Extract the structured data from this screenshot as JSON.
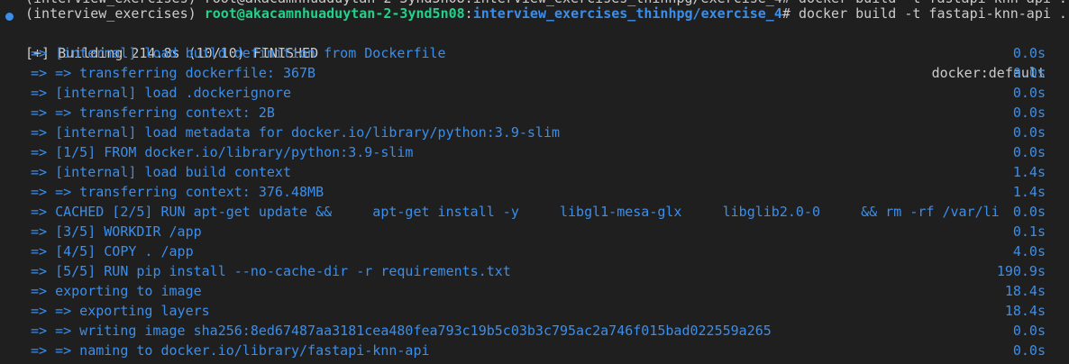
{
  "colors": {
    "background": "#1f1f1f",
    "text": "#cccccc",
    "step_text": "#3b8eea",
    "user_host": "#23d18b",
    "cwd": "#3b8eea",
    "prompt_marker": "#3b8eea"
  },
  "prompt": {
    "marker_icon": "circle-dot",
    "cutoff_text": "(interview_exercises) root@akacamnhuaduytan-2-3ynd5n08:interview_exercises_thinhpg/exercise_4# docker build -t fastapi-knn-api .",
    "venv": "(interview_exercises) ",
    "user_host": "root@akacamnhuaduytan-2-3ynd5n08",
    "separator": ":",
    "cwd": "interview_exercises_thinhpg/exercise_4",
    "symbol": "# ",
    "command": "docker build -t fastapi-knn-api ."
  },
  "build_header": {
    "text": "[+] Building 214.8s (10/10) FINISHED",
    "builder": "docker:default"
  },
  "steps": [
    {
      "text": "=> [internal] load build definition from Dockerfile",
      "time": "0.0s"
    },
    {
      "text": "=> => transferring dockerfile: 367B",
      "time": "0.0s"
    },
    {
      "text": "=> [internal] load .dockerignore",
      "time": "0.0s"
    },
    {
      "text": "=> => transferring context: 2B",
      "time": "0.0s"
    },
    {
      "text": "=> [internal] load metadata for docker.io/library/python:3.9-slim",
      "time": "0.0s"
    },
    {
      "text": "=> [1/5] FROM docker.io/library/python:3.9-slim",
      "time": "0.0s"
    },
    {
      "text": "=> [internal] load build context",
      "time": "1.4s"
    },
    {
      "text": "=> => transferring context: 376.48MB",
      "time": "1.4s"
    },
    {
      "text": "=> CACHED [2/5] RUN apt-get update &&     apt-get install -y     libgl1-mesa-glx     libglib2.0-0     && rm -rf /var/li",
      "time": "0.0s"
    },
    {
      "text": "=> [3/5] WORKDIR /app",
      "time": "0.1s"
    },
    {
      "text": "=> [4/5] COPY . /app",
      "time": "4.0s"
    },
    {
      "text": "=> [5/5] RUN pip install --no-cache-dir -r requirements.txt",
      "time": "190.9s"
    },
    {
      "text": "=> exporting to image",
      "time": "18.4s"
    },
    {
      "text": "=> => exporting layers",
      "time": "18.4s"
    },
    {
      "text": "=> => writing image sha256:8ed67487aa3181cea480fea793c19b5c03b3c795ac2a746f015bad022559a265",
      "time": "0.0s"
    },
    {
      "text": "=> => naming to docker.io/library/fastapi-knn-api",
      "time": "0.0s"
    }
  ]
}
